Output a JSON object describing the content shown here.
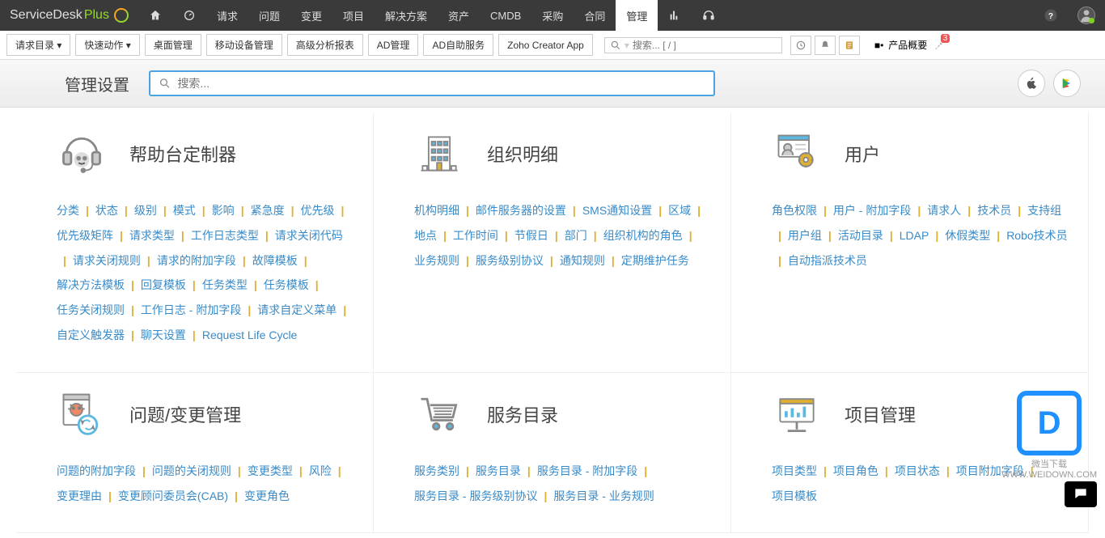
{
  "brand": {
    "name": "ServiceDesk",
    "suffix": "Plus"
  },
  "topnav": {
    "items": [
      "请求",
      "问题",
      "变更",
      "项目",
      "解决方案",
      "资产",
      "CMDB",
      "采购",
      "合同",
      "管理"
    ],
    "active_index": 9
  },
  "toolbar": {
    "btns": [
      "请求目录 ▾",
      "快速动作 ▾",
      "桌面管理",
      "移动设备管理",
      "高级分析报表",
      "AD管理",
      "AD自助服务",
      "Zoho Creator App"
    ],
    "search_placeholder": "搜索... [ / ]",
    "product_label": "产品概要",
    "pin_badge": "3"
  },
  "page": {
    "title": "管理设置",
    "search_placeholder": "搜索..."
  },
  "cards": [
    {
      "title": "帮助台定制器",
      "icon": "headset",
      "links": [
        "分类",
        "状态",
        "级别",
        "模式",
        "影响",
        "紧急度",
        "优先级",
        "优先级矩阵",
        "请求类型",
        "工作日志类型",
        "请求关闭代码",
        "请求关闭规则",
        "请求的附加字段",
        "故障模板",
        "解决方法模板",
        "回复模板",
        "任务类型",
        "任务模板",
        "任务关闭规则",
        "工作日志 - 附加字段",
        "请求自定义菜单",
        "自定义触发器",
        "聊天设置",
        "Request Life Cycle"
      ]
    },
    {
      "title": "组织明细",
      "icon": "building",
      "links": [
        "机构明细",
        "邮件服务器的设置",
        "SMS通知设置",
        "区域",
        "地点",
        "工作时间",
        "节假日",
        "部门",
        "组织机构的角色",
        "业务规则",
        "服务级别协议",
        "通知规则",
        "定期维护任务"
      ]
    },
    {
      "title": "用户",
      "icon": "users",
      "links": [
        "角色权限",
        "用户 - 附加字段",
        "请求人",
        "技术员",
        "支持组",
        "用户组",
        "活动目录",
        "LDAP",
        "休假类型",
        "Robo技术员",
        "自动指派技术员"
      ]
    },
    {
      "title": "问题/变更管理",
      "icon": "change",
      "links": [
        "问题的附加字段",
        "问题的关闭规则",
        "变更类型",
        "风险",
        "变更理由",
        "变更顾问委员会(CAB)",
        "变更角色"
      ]
    },
    {
      "title": "服务目录",
      "icon": "cart",
      "links": [
        "服务类别",
        "服务目录",
        "服务目录 - 附加字段",
        "服务目录 - 服务级别协议",
        "服务目录 - 业务规则"
      ]
    },
    {
      "title": "项目管理",
      "icon": "project",
      "links": [
        "项目类型",
        "项目角色",
        "项目状态",
        "项目附加字段",
        "项目模板"
      ]
    }
  ],
  "watermark": {
    "line1": "微当下载",
    "line2": "WWW.WEIDOWN.COM"
  }
}
